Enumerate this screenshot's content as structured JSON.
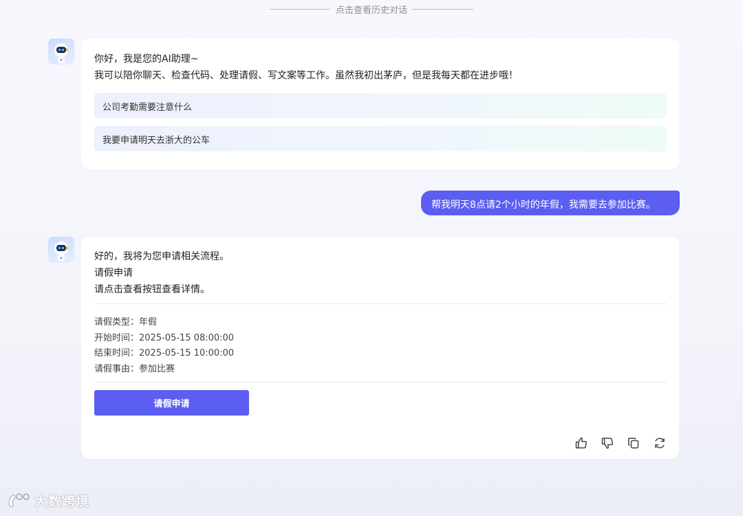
{
  "history_link": "点击查看历史对话",
  "bot_greeting": {
    "line1": "你好，我是您的AI助理~",
    "line2": "我可以陪你聊天、检查代码、处理请假、写文案等工作。虽然我初出茅庐，但是我每天都在进步哦！",
    "suggestions": [
      "公司考勤需要注意什么",
      "我要申请明天去浙大的公车"
    ]
  },
  "user_message": "帮我明天8点请2个小时的年假，我需要去参加比赛。",
  "bot_reply": {
    "line1": "好的，我将为您申请相关流程。",
    "line2": "请假申请",
    "line3": "请点击查看按钮查看详情。",
    "details": [
      "请假类型：年假",
      "开始时间：2025-05-15 08:00:00",
      "结束时间：2025-05-15 10:00:00",
      "请假事由：参加比赛"
    ],
    "button_label": "请假申请",
    "action_icons": [
      "thumbs-up-icon",
      "thumbs-down-icon",
      "copy-icon",
      "refresh-icon"
    ]
  },
  "watermark": "大数跨境",
  "colors": {
    "accent": "#5b5ef0",
    "background": "#f4f4fb",
    "card": "#ffffff"
  }
}
